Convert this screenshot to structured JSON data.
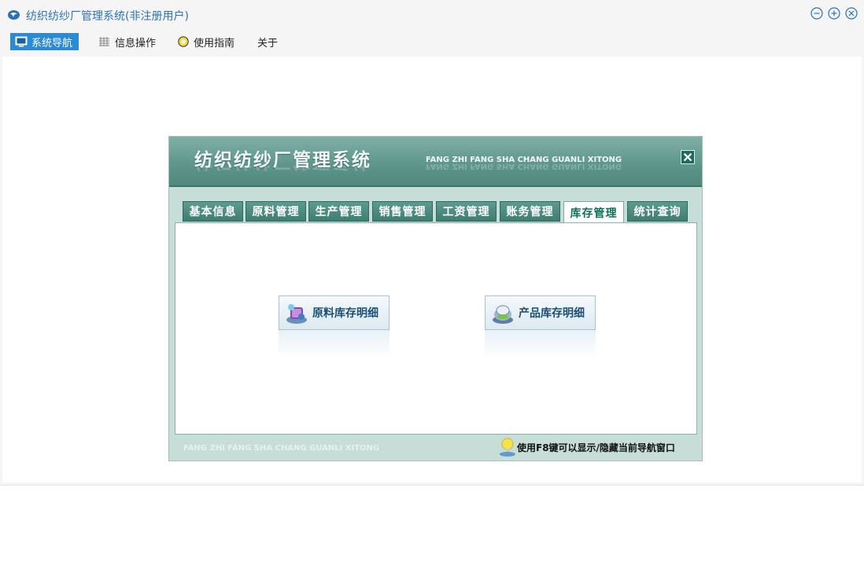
{
  "window": {
    "title": "纺织纺纱厂管理系统(非注册用户)",
    "controls": [
      "minimize-icon",
      "maximize-icon",
      "close-icon"
    ]
  },
  "menu": {
    "items": [
      {
        "label": "系统导航",
        "icon": "monitor-icon",
        "active": true
      },
      {
        "label": "信息操作",
        "icon": "grid-icon",
        "active": false
      },
      {
        "label": "使用指南",
        "icon": "info-circle-icon",
        "active": false
      },
      {
        "label": "关于",
        "icon": "",
        "active": false
      }
    ]
  },
  "dialog": {
    "title": "纺织纺纱厂管理系统",
    "subtitle": "FANG ZHI FANG SHA CHANG GUANLI XITONG",
    "tabs": [
      {
        "label": "基本信息",
        "active": false
      },
      {
        "label": "原料管理",
        "active": false
      },
      {
        "label": "生产管理",
        "active": false
      },
      {
        "label": "销售管理",
        "active": false
      },
      {
        "label": "工资管理",
        "active": false
      },
      {
        "label": "账务管理",
        "active": false
      },
      {
        "label": "库存管理",
        "active": true
      },
      {
        "label": "统计查询",
        "active": false
      }
    ],
    "buttons": [
      {
        "label": "原料库存明细",
        "icon": "material-stock-icon"
      },
      {
        "label": "产品库存明细",
        "icon": "product-stock-icon"
      }
    ],
    "footer_left": "FANG ZHI FANG SHA CHANG GUANLI XITONG",
    "footer_hint": "使用F8键可以显示/隐藏当前导航窗口"
  },
  "colors": {
    "accent": "#2a8ad6",
    "title_blue": "#2a72b5",
    "dialog_green": "#5f968c",
    "tab_active_text": "#0f6f5d"
  }
}
